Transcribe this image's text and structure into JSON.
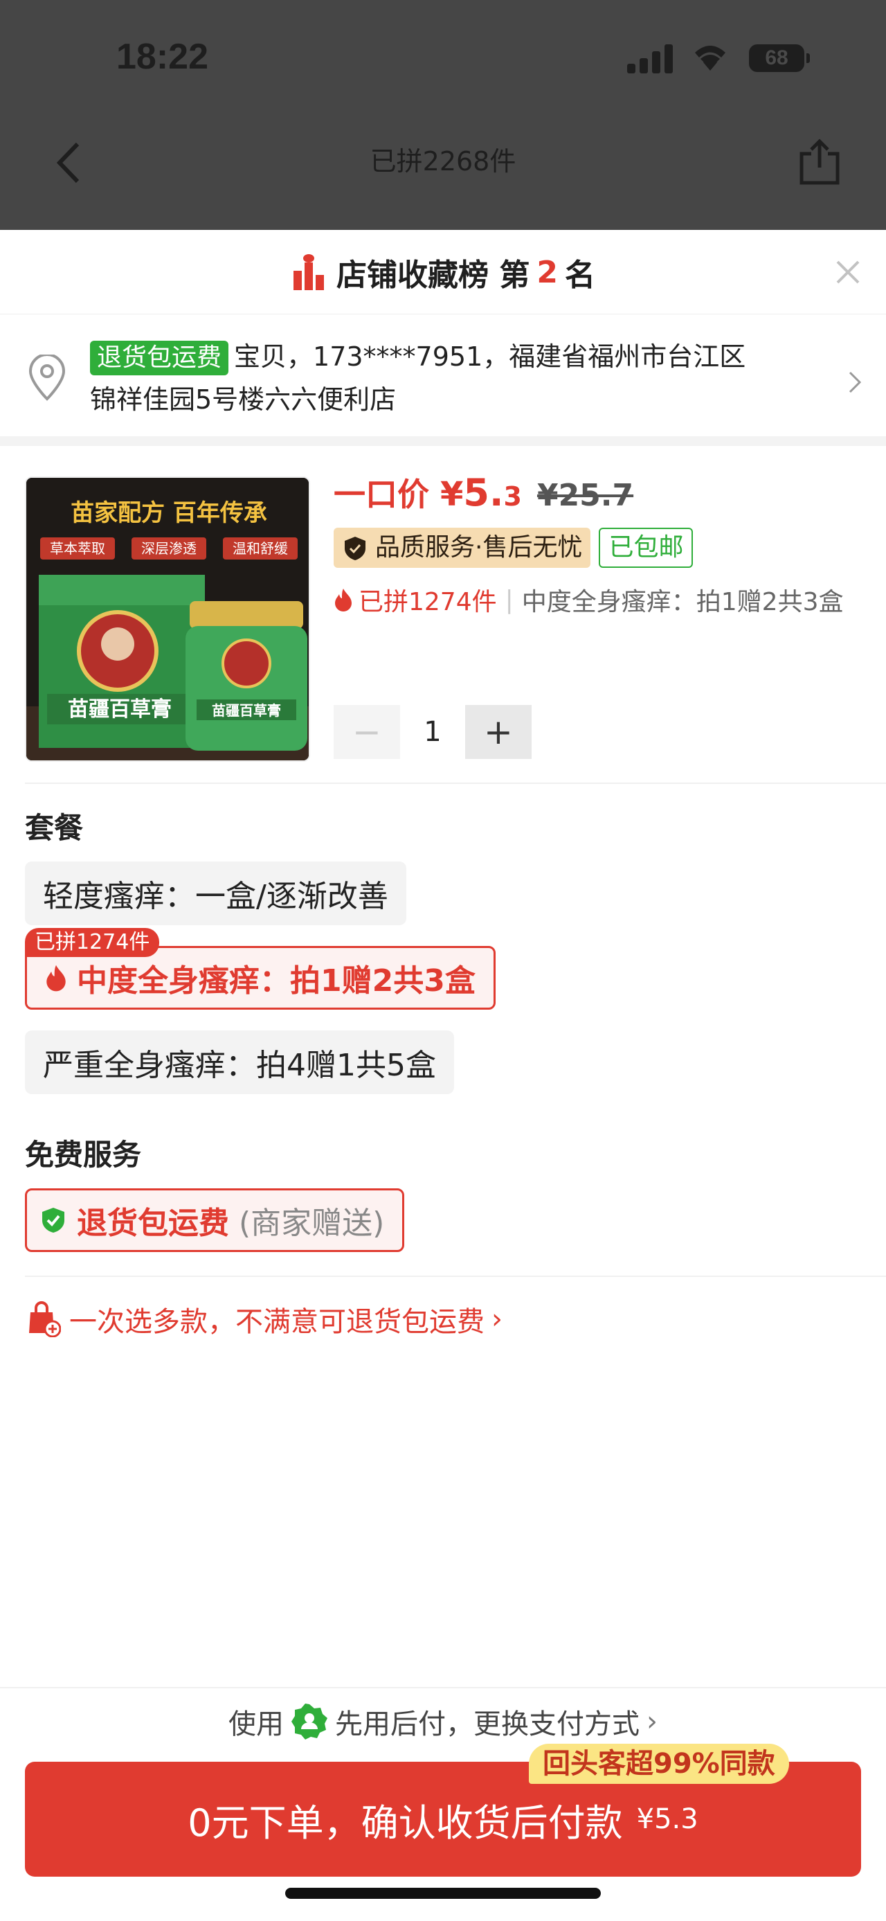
{
  "status_bar": {
    "time": "18:22",
    "battery": "68"
  },
  "nav": {
    "title": "已拼2268件"
  },
  "rank": {
    "prefix": "店铺收藏榜 第",
    "number": "2",
    "suffix": "名"
  },
  "address": {
    "tag": "退货包运费",
    "line1": "宝贝，173****7951，福建省福州市台江区",
    "line2": "锦祥佳园5号楼六六便利店"
  },
  "product": {
    "image_text_top": "苗家配方 百年传承",
    "image_tags": [
      "草本萃取",
      "深层渗透",
      "温和舒缓"
    ],
    "image_box_name": "苗疆百草膏",
    "price_label": "一口价",
    "price_symbol": "¥",
    "price_int": "5.",
    "price_dec": "3",
    "price_old": "¥25.7",
    "badge_quality": "品质服务·售后无忧",
    "badge_free": "已包邮",
    "sold": "已拼1274件",
    "selected_summary": "中度全身瘙痒：拍1赠2共3盒",
    "quantity": "1"
  },
  "package": {
    "title": "套餐",
    "options": [
      "轻度瘙痒：一盒/逐渐改善",
      "中度全身瘙痒：拍1赠2共3盒",
      "严重全身瘙痒：拍4赠1共5盒"
    ],
    "selected_tag": "已拼1274件"
  },
  "service": {
    "title": "免费服务",
    "main": "退货包运费",
    "sub": "(商家赠送)"
  },
  "promo": {
    "text": "一次选多款，不满意可退货包运费"
  },
  "payment": {
    "prefix": "使用",
    "text": "先用后付，更换支付方式"
  },
  "cta": {
    "label": "0元下单，确认收货后付款",
    "price": "¥5.3",
    "badge": "回头客超99%同款"
  },
  "colors": {
    "accent": "#e03b30",
    "green": "#2fae3a",
    "gold": "#f6dcb2"
  }
}
